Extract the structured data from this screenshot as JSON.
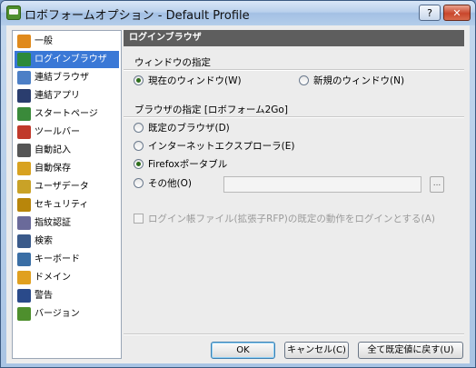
{
  "window": {
    "title": "ロボフォームオプション - Default Profile",
    "help_label": "?",
    "close_label": "✕"
  },
  "sidebar": {
    "items": [
      {
        "label": "一般",
        "icon": "gear-icon",
        "color": "#e08a1c"
      },
      {
        "label": "ログインブラウザ",
        "icon": "globe-icon",
        "color": "#2c8a3a"
      },
      {
        "label": "連結ブラウザ",
        "icon": "linked-browser-icon",
        "color": "#4c7fc6"
      },
      {
        "label": "連結アプリ",
        "icon": "linked-app-icon",
        "color": "#2a3d6e"
      },
      {
        "label": "スタートページ",
        "icon": "home-icon",
        "color": "#3a8a3a"
      },
      {
        "label": "ツールバー",
        "icon": "toolbar-icon",
        "color": "#c0392b"
      },
      {
        "label": "自動記入",
        "icon": "keyboard-icon",
        "color": "#555555"
      },
      {
        "label": "自動保存",
        "icon": "save-icon",
        "color": "#d8a220"
      },
      {
        "label": "ユーザデータ",
        "icon": "user-data-icon",
        "color": "#c9a227"
      },
      {
        "label": "セキュリティ",
        "icon": "lock-icon",
        "color": "#b8860b"
      },
      {
        "label": "指紋認証",
        "icon": "fingerprint-icon",
        "color": "#6a6a9a"
      },
      {
        "label": "検索",
        "icon": "search-icon",
        "color": "#3a5a8a"
      },
      {
        "label": "キーボード",
        "icon": "cursor-icon",
        "color": "#3a6ea5"
      },
      {
        "label": "ドメイン",
        "icon": "dotcom-icon",
        "color": "#e0a020"
      },
      {
        "label": "警告",
        "icon": "checkbox-icon",
        "color": "#2a4a8a"
      },
      {
        "label": "バージョン",
        "icon": "robot-icon",
        "color": "#4e8f2d"
      }
    ],
    "selected_index": 1
  },
  "panel": {
    "header": "ログインブラウザ",
    "window_group": {
      "title": "ウィンドウの指定",
      "options": [
        {
          "label": "現在のウィンドウ(W)",
          "checked": true
        },
        {
          "label": "新規のウィンドウ(N)",
          "checked": false
        }
      ]
    },
    "browser_group": {
      "title": "ブラウザの指定 [ロボフォーム2Go]",
      "options": [
        {
          "label": "既定のブラウザ(D)",
          "checked": false
        },
        {
          "label": "インターネットエクスプローラ(E)",
          "checked": false
        },
        {
          "label": "Firefoxポータブル",
          "checked": true
        },
        {
          "label": "その他(O)",
          "checked": false
        }
      ],
      "other_path_value": "",
      "browse_label": "..."
    },
    "rfp_checkbox": {
      "label": "ログイン帳ファイル(拡張子RFP)の既定の動作をログインとする(A)",
      "checked": false,
      "enabled": false
    }
  },
  "buttons": {
    "ok": "OK",
    "cancel": "キャンセル(C)",
    "reset": "全て既定値に戻す(U)"
  }
}
